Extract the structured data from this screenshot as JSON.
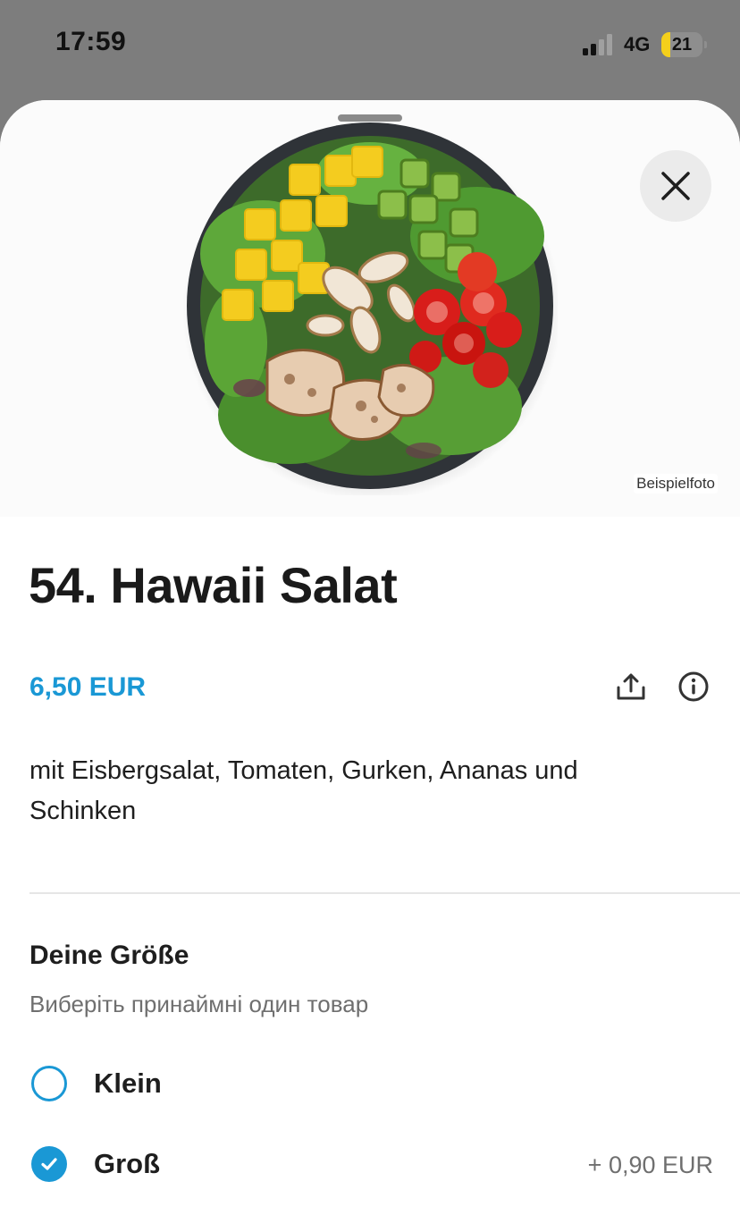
{
  "status_bar": {
    "time": "17:59",
    "network": "4G",
    "battery_level": "21",
    "battery_fraction": 0.21,
    "battery_color": "#f4cf1b"
  },
  "photo": {
    "caption": "Beispielfoto"
  },
  "item": {
    "title": "54. Hawaii Salat",
    "price": "6,50 EUR",
    "description": "mit Eisbergsalat, Tomaten, Gurken, Ananas und Schinken"
  },
  "icons": {
    "close": "close-icon",
    "share": "share-icon",
    "info": "info-icon",
    "check": "check-icon"
  },
  "size_section": {
    "title": "Deine Größe",
    "hint": "Виберіть принаймні один товар",
    "options": [
      {
        "label": "Klein",
        "extra": "",
        "selected": false
      },
      {
        "label": "Groß",
        "extra": "+ 0,90 EUR",
        "selected": true
      }
    ]
  },
  "colors": {
    "accent": "#1a98d5",
    "text": "#1e1e1e",
    "muted": "#6f6f6f"
  }
}
